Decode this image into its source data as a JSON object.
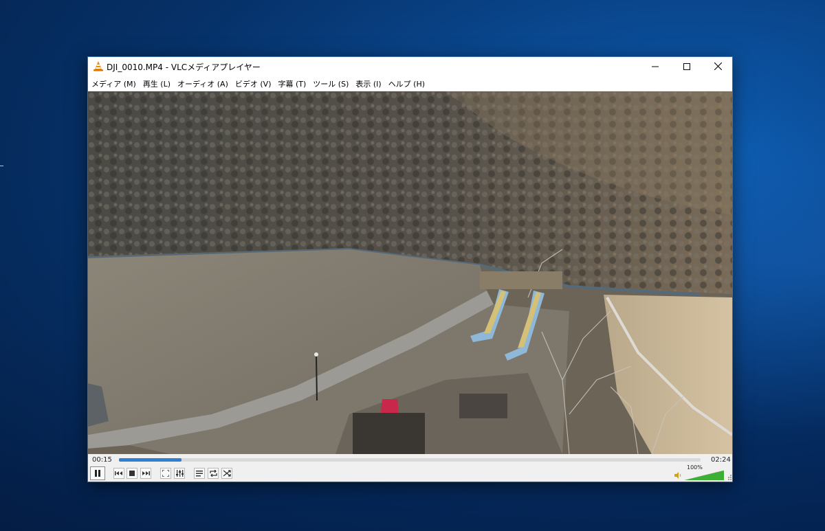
{
  "window": {
    "title": "DJI_0010.MP4 - VLCメディアプレイヤー",
    "icons": {
      "app": "vlc-cone-icon",
      "minimize": "minimize-icon",
      "maximize": "maximize-icon",
      "close": "close-icon"
    }
  },
  "menu": {
    "items": [
      {
        "label": "メディア (M)"
      },
      {
        "label": "再生 (L)"
      },
      {
        "label": "オーディオ (A)"
      },
      {
        "label": "ビデオ (V)"
      },
      {
        "label": "字幕 (T)"
      },
      {
        "label": "ツール (S)"
      },
      {
        "label": "表示 (I)"
      },
      {
        "label": "ヘルプ (H)"
      }
    ]
  },
  "player": {
    "elapsed": "00:15",
    "total": "02:24",
    "progress": 0.107,
    "volume_label": "100%",
    "volume": 1.0,
    "buttons": [
      "pause-icon",
      "previous-icon",
      "stop-icon",
      "next-icon",
      "fullscreen-icon",
      "extended-settings-icon",
      "playlist-icon",
      "loop-icon",
      "shuffle-icon"
    ],
    "accent_color": "#2f7fd1",
    "volume_color": "#3cb034"
  }
}
